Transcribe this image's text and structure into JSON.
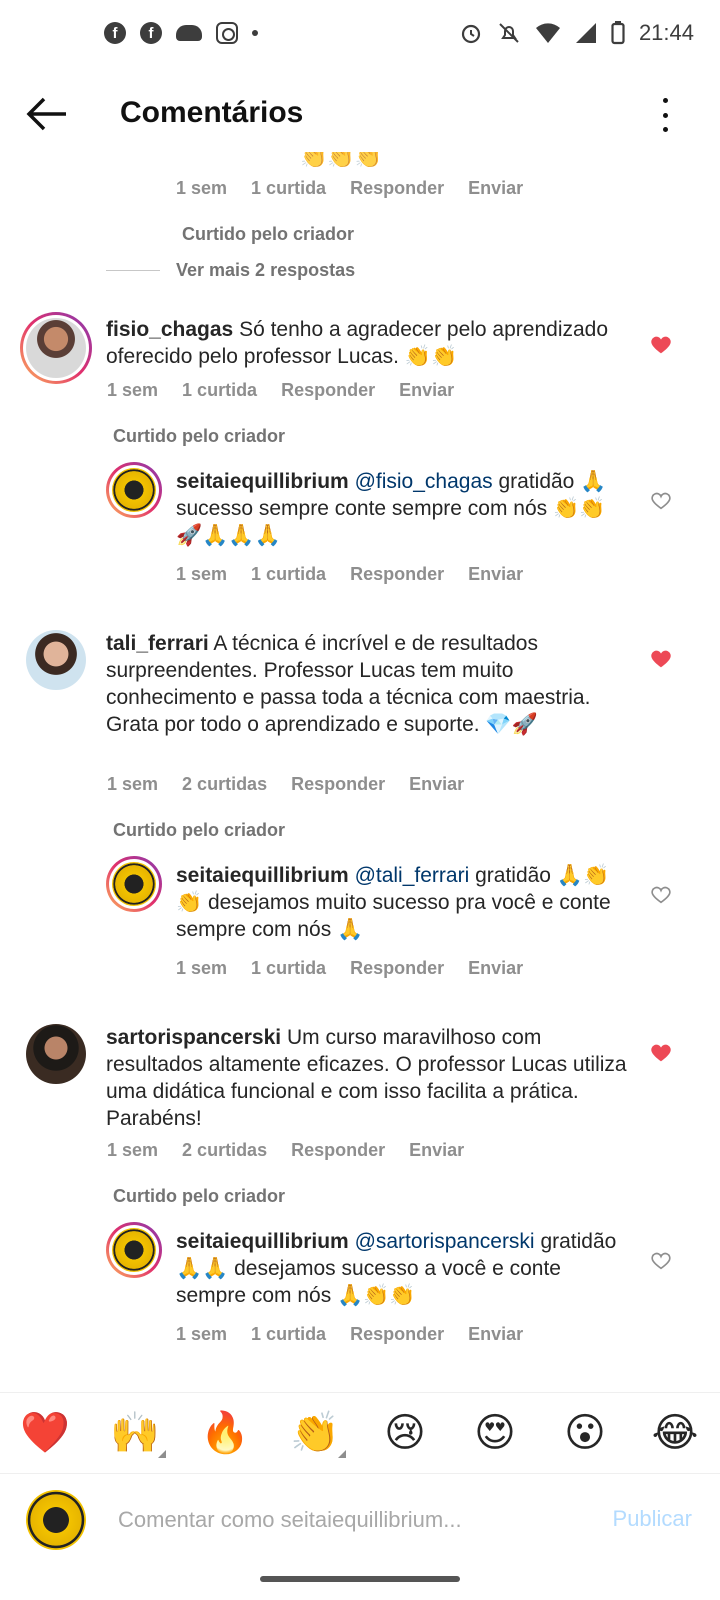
{
  "status_bar": {
    "time": "21:44"
  },
  "header": {
    "title": "Comentários"
  },
  "top_partial": {
    "meta": [
      "1 sem",
      "1 curtida",
      "Responder",
      "Enviar"
    ],
    "liked_by_creator": "Curtido pelo criador",
    "more_replies": "Ver mais 2 respostas"
  },
  "comments": [
    {
      "user": "fisio_chagas",
      "text": "Só tenho a agradecer pelo aprendizado oferecido pelo professor Lucas. 👏👏",
      "time": "1 sem",
      "likes": "1 curtida",
      "reply": "Responder",
      "send": "Enviar",
      "liked_by_creator": "Curtido pelo criador",
      "reply_item": {
        "user": "seitaiequillibrium",
        "mention": "@fisio_chagas",
        "text": "gratidão 🙏 sucesso sempre conte sempre com nós 👏👏🚀🙏🙏🙏",
        "time": "1 sem",
        "likes": "1 curtida",
        "reply": "Responder",
        "send": "Enviar"
      }
    },
    {
      "user": "tali_ferrari",
      "text": "A técnica é incrível e de resultados surpreendentes. Professor Lucas tem muito conhecimento e passa toda a técnica com maestria. Grata por todo o aprendizado e suporte. 💎🚀",
      "time": "1 sem",
      "likes": "2 curtidas",
      "reply": "Responder",
      "send": "Enviar",
      "liked_by_creator": "Curtido pelo criador",
      "reply_item": {
        "user": "seitaiequillibrium",
        "mention": "@tali_ferrari",
        "text": "gratidão 🙏👏👏 desejamos muito sucesso pra você e conte sempre com nós 🙏",
        "time": "1 sem",
        "likes": "1 curtida",
        "reply": "Responder",
        "send": "Enviar"
      }
    },
    {
      "user": "sartorispancerski",
      "text": "Um curso maravilhoso com resultados altamente eficazes. O professor Lucas utiliza uma didática funcional  e com isso facilita a prática. Parabéns!",
      "time": "1 sem",
      "likes": "2 curtidas",
      "reply": "Responder",
      "send": "Enviar",
      "liked_by_creator": "Curtido pelo criador",
      "reply_item": {
        "user": "seitaiequillibrium",
        "mention": "@sartorispancerski",
        "text": "gratidão 🙏🙏 desejamos sucesso a você e conte sempre com nós 🙏👏👏",
        "time": "1 sem",
        "likes": "1 curtida",
        "reply": "Responder",
        "send": "Enviar"
      }
    }
  ],
  "emoji_bar": [
    "❤️",
    "🙌",
    "🔥",
    "👏",
    "😢",
    "😍",
    "😮",
    "😂"
  ],
  "composer": {
    "placeholder": "Comentar como seitaiequillibrium...",
    "publish": "Publicar"
  },
  "colors": {
    "heart_red": "#ed4956",
    "mention": "#00376b",
    "publish": "#b3dbff"
  }
}
